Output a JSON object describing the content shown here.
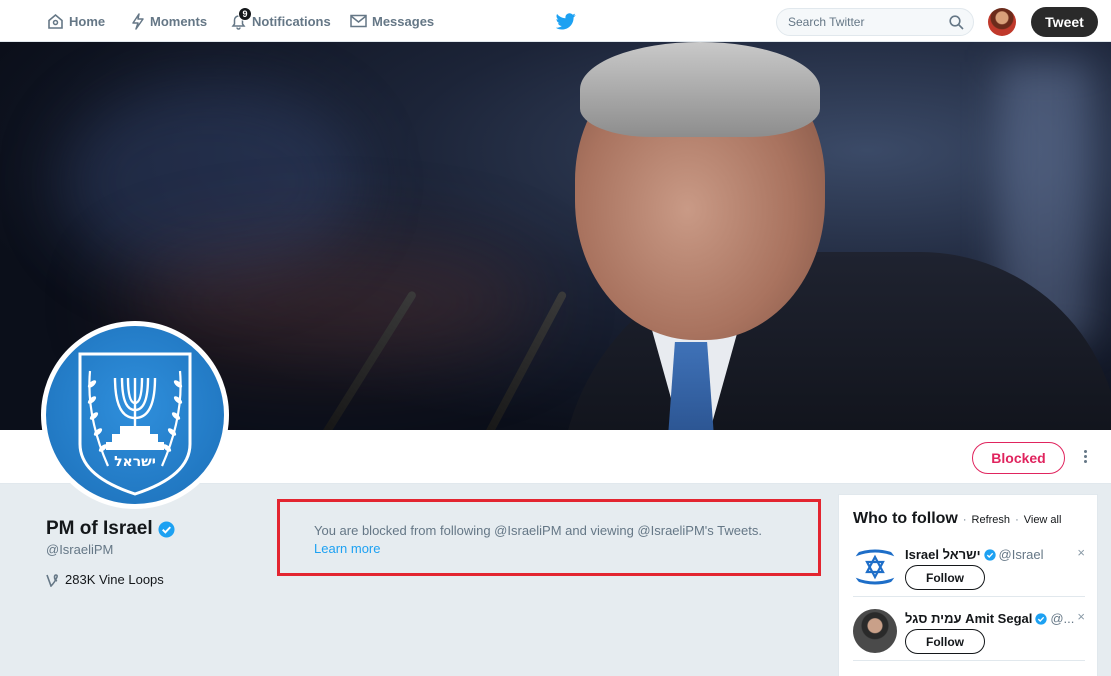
{
  "nav": {
    "home": "Home",
    "moments": "Moments",
    "notifications": "Notifications",
    "notifications_count": "9",
    "messages": "Messages",
    "search_placeholder": "Search Twitter",
    "tweet_button": "Tweet"
  },
  "profile": {
    "name": "PM of Israel",
    "handle": "@IsraeliPM",
    "vine_loops": "283K Vine Loops",
    "blocked_button": "Blocked",
    "emblem_text": "ישראל"
  },
  "blocked_notice": {
    "message": "You are blocked from following @IsraeliPM and viewing @IsraeliPM's Tweets.",
    "link": "Learn more"
  },
  "who_to_follow": {
    "title": "Who to follow",
    "refresh": "Refresh",
    "separator": "·",
    "view_all": "View all",
    "suggestions": [
      {
        "name": "Israel ישראל",
        "handle": "@Israel",
        "follow": "Follow",
        "close": "×"
      },
      {
        "name": "עמית סגל Amit Segal",
        "handle": "@...",
        "follow": "Follow",
        "close": "×"
      }
    ]
  },
  "colors": {
    "twitter_blue": "#1da1f2",
    "blocked_red": "#e0245e",
    "highlight_box": "#e32530"
  }
}
